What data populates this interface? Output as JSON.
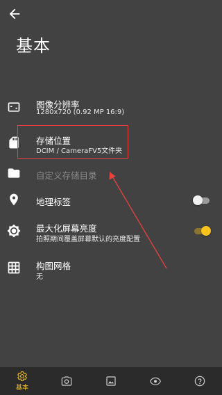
{
  "header": {
    "title": "基本"
  },
  "settings": [
    {
      "title": "图像分辨率",
      "subtitle": "1280x720 (0.92 MP 16:9)"
    },
    {
      "title": "存储位置",
      "subtitle": "DCIM / CameraFV5文件夹"
    },
    {
      "title": "自定义存储目录"
    },
    {
      "title": "地理标签",
      "toggle": "off"
    },
    {
      "title": "最大化屏幕亮度",
      "subtitle": "拍照期间覆盖屏幕默认的亮度配置",
      "toggle": "on"
    },
    {
      "title": "构图网格",
      "subtitle": "无"
    }
  ],
  "bottom_nav": {
    "active_label": "基本"
  },
  "colors": {
    "accent": "#f6c21c",
    "annotation": "#e8413e",
    "background": "#424242",
    "nav_background": "#2b2b2b"
  }
}
